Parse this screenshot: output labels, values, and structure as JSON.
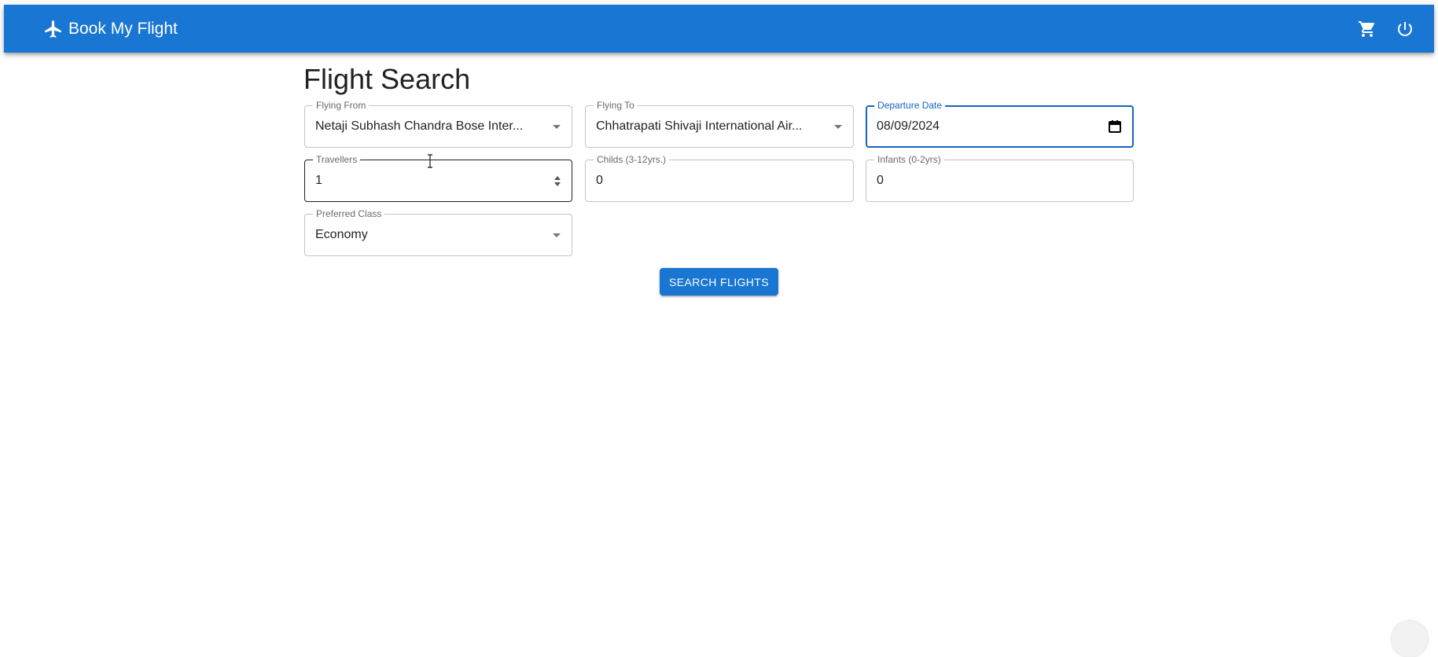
{
  "colors": {
    "primary": "#1976d2",
    "focused_border": "#1565c0",
    "label_focused": "#1565c0"
  },
  "appbar": {
    "title": "Book My Flight",
    "brand_icon": "airplane-icon",
    "actions": [
      {
        "icon": "cart-icon"
      },
      {
        "icon": "power-icon"
      }
    ]
  },
  "page": {
    "title": "Flight Search"
  },
  "form": {
    "flying_from": {
      "label": "Flying From",
      "value": "Netaji Subhash Chandra Bose Inter..."
    },
    "flying_to": {
      "label": "Flying To",
      "value": "Chhatrapati Shivaji International Air..."
    },
    "departure_date": {
      "label": "Departure Date",
      "value": "08/09/2024"
    },
    "travellers": {
      "label": "Travellers",
      "value": "1"
    },
    "childs": {
      "label": "Childs (3-12yrs.)",
      "value": "0"
    },
    "infants": {
      "label": "Infants (0-2yrs)",
      "value": "0"
    },
    "preferred_class": {
      "label": "Preferred Class",
      "value": "Economy"
    },
    "search_button": "SEARCH FLIGHTS"
  }
}
